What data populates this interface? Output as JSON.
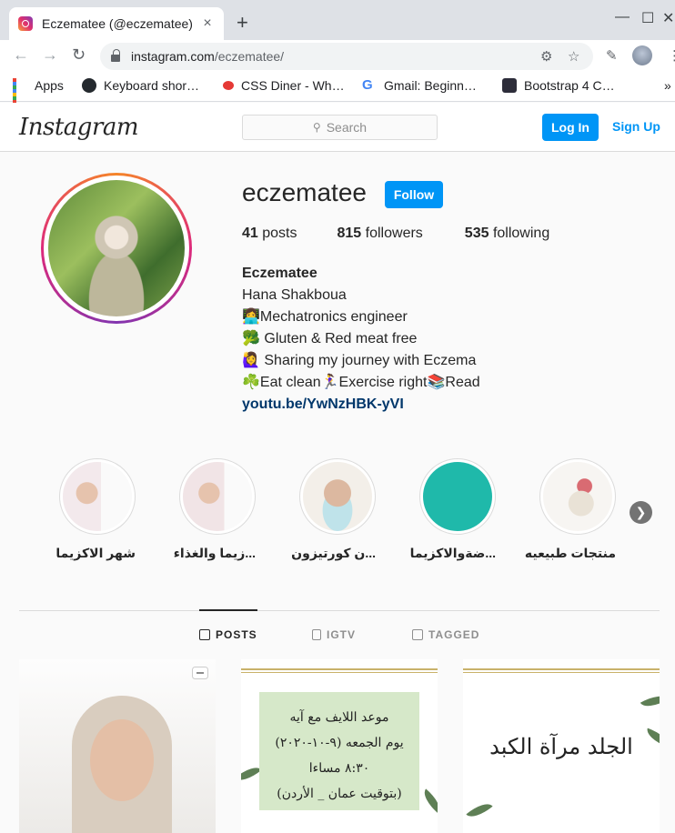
{
  "browser": {
    "tab_title": "Eczematee (@eczematee)",
    "tab_close": "×",
    "new_tab": "+",
    "url_host": "instagram.com",
    "url_path": "/eczematee/",
    "bookmarks": [
      {
        "label": "Apps"
      },
      {
        "label": "Keyboard shor…"
      },
      {
        "label": "CSS Diner - Wh…"
      },
      {
        "label": "Gmail: Beginn…"
      },
      {
        "label": "Bootstrap 4 C…"
      }
    ],
    "more_bookmarks": "»"
  },
  "instagram": {
    "logo": "Instagram",
    "search_placeholder": "Search",
    "login_label": "Log In",
    "signup_label": "Sign Up"
  },
  "profile": {
    "username": "eczematee",
    "follow_label": "Follow",
    "stats": [
      {
        "count": "41",
        "label": "posts"
      },
      {
        "count": "815",
        "label": "followers"
      },
      {
        "count": "535",
        "label": "following"
      }
    ],
    "bio_name": "Eczematee",
    "bio_lines": [
      "Hana Shakboua",
      "👩‍💻Mechatronics engineer",
      "🥦 Gluten & Red meat free",
      "🙋‍♀️ Sharing my journey with Eczema",
      "☘️Eat clean🏃‍♀️Exercise right📚Read"
    ],
    "bio_link": "youtu.be/YwNzHBK-yVI"
  },
  "highlights": [
    {
      "label": "شهر الاكزيما"
    },
    {
      "label": "...زيما والغذاء"
    },
    {
      "label": "...ن كورتيزون"
    },
    {
      "label": "...ضةوالاكزيما"
    },
    {
      "label": "منتجات طبيعيه"
    }
  ],
  "profile_tabs": [
    {
      "label": "POSTS",
      "active": true
    },
    {
      "label": "IGTV",
      "active": false
    },
    {
      "label": "TAGGED",
      "active": false
    }
  ],
  "posts": [
    {
      "text": ""
    },
    {
      "lines": [
        "موعد اللايف مع آيه",
        "يوم الجمعه (٩-١٠-٢٠٢٠)",
        "٨:٣٠ مساءا",
        "(بتوقيت عمان _ الأردن)"
      ]
    },
    {
      "text": "الجلد مرآة الكبد"
    }
  ]
}
